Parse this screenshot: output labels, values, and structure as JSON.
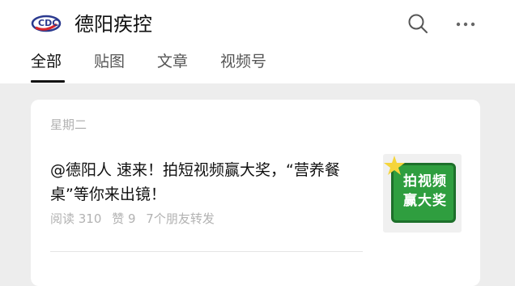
{
  "header": {
    "account_name": "德阳疾控",
    "logo_icon": "dycdc-logo-icon",
    "actions": [
      {
        "icon": "search-icon"
      },
      {
        "icon": "more-icon"
      }
    ]
  },
  "tabs": [
    {
      "label": "全部",
      "active": true
    },
    {
      "label": "贴图",
      "active": false
    },
    {
      "label": "文章",
      "active": false
    },
    {
      "label": "视频号",
      "active": false
    }
  ],
  "feed": {
    "day_label": "星期二",
    "articles": [
      {
        "title": "@德阳人 速来！拍短视频赢大奖，“营养餐桌”等你来出镜！",
        "reads": "阅读 310",
        "likes": "赞 9",
        "friends": "7个朋友转发",
        "thumbnail_text": "拍视频赢大奖"
      }
    ]
  },
  "colors": {
    "accent_text": "#111111",
    "meta_text": "#b2b2b2",
    "background": "#ededed",
    "thumbnail_green": "#2f9e3f"
  }
}
